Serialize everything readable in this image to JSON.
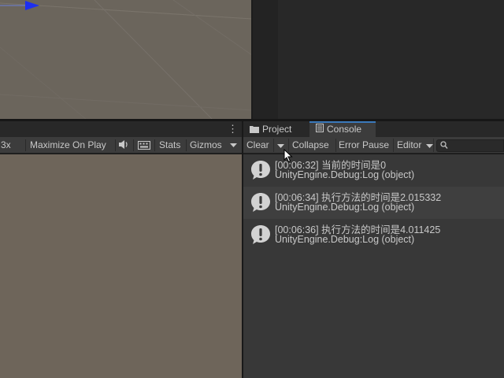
{
  "game": {
    "toolbar": {
      "scale_label": "3x",
      "maximize_label": "Maximize On Play",
      "audio_icon": "speaker-icon",
      "keyboard_icon": "keyboard-icon",
      "stats_label": "Stats",
      "gizmos_label": "Gizmos"
    }
  },
  "console": {
    "tabs": [
      {
        "label": "Project",
        "icon": "folder-icon",
        "active": false
      },
      {
        "label": "Console",
        "icon": "console-icon",
        "active": true
      }
    ],
    "toolbar": {
      "clear_label": "Clear",
      "collapse_label": "Collapse",
      "error_pause_label": "Error Pause",
      "editor_label": "Editor",
      "search_icon": "search-icon"
    },
    "entries": [
      {
        "message": "[00:06:32] 当前的时间是0",
        "stack": "UnityEngine.Debug:Log (object)"
      },
      {
        "message": "[00:06:34] 执行方法的时间是2.015332",
        "stack": "UnityEngine.Debug:Log (object)"
      },
      {
        "message": "[00:06:36] 执行方法的时间是4.011425",
        "stack": "UnityEngine.Debug:Log (object)"
      }
    ]
  },
  "colors": {
    "accent_tab": "#3a79bb",
    "scene_bg": "#6b655c",
    "console_bg": "#383838"
  }
}
